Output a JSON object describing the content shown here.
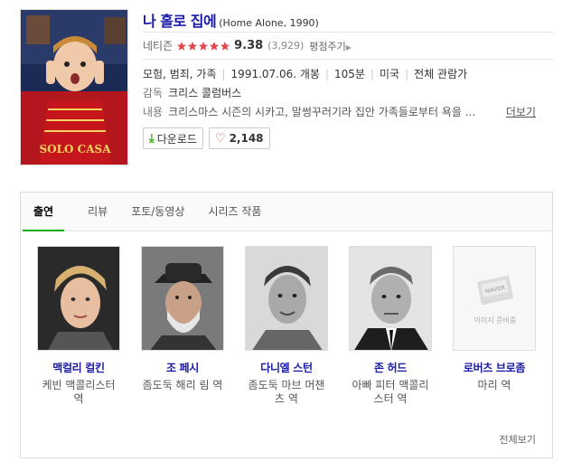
{
  "movie": {
    "title": "나 홀로 집에",
    "subtitle": "(Home Alone, 1990)",
    "rating_label": "네티즌",
    "stars": 5,
    "score": "9.38",
    "review_count": "(3,929)",
    "rate_link": "평점주기",
    "genre": "모험, 범죄, 가족",
    "release": "1991.07.06. 개봉",
    "runtime": "105분",
    "country": "미국",
    "age": "전체 관람가",
    "director_label": "감독",
    "director": "크리스 콜럼버스",
    "desc_label": "내용",
    "desc": "크리스마스 시즌의 시카고, 말썽꾸러기라 집안 가족들로부터 욕을 ...",
    "more_link": "더보기",
    "download_label": "다운로드",
    "likes": "2,148",
    "poster_text": "SOLO  CASA"
  },
  "tabs": [
    "출연",
    "리뷰",
    "포토/동영상",
    "시리즈 작품"
  ],
  "cast": [
    {
      "name": "맥컬리 컬킨",
      "role": "케빈 맥콜리스터 역"
    },
    {
      "name": "조 페시",
      "role": "좀도둑 해리 림 역"
    },
    {
      "name": "다니엘 스턴",
      "role": "좀도둑 마브 머챈츠 역"
    },
    {
      "name": "존 허드",
      "role": "아빠 피터 맥콜리스터 역"
    },
    {
      "name": "로버츠 브로좀",
      "role": "마리 역",
      "placeholder": "이미지 준비중",
      "placeholder_logo": "NAVER"
    }
  ],
  "see_all": "전체보기",
  "colors": {
    "title": "#1a1aa6",
    "star": "#e0484d",
    "tab_active": "#1aad19",
    "download_icon": "#2db400"
  }
}
